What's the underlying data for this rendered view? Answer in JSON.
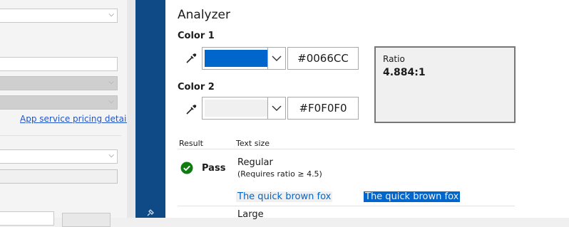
{
  "left_pane": {
    "pricing_link": "App service pricing details"
  },
  "analyzer": {
    "title": "Analyzer",
    "color1": {
      "label": "Color 1",
      "hex": "#0066CC",
      "swatch": "#0066CC"
    },
    "color2": {
      "label": "Color 2",
      "hex": "#F0F0F0",
      "swatch": "#F0F0F0"
    },
    "ratio": {
      "label": "Ratio",
      "value": "4.884:1"
    },
    "table": {
      "col_result": "Result",
      "col_text_size": "Text size",
      "rows": [
        {
          "result": "Pass",
          "size": "Regular",
          "requirement": "(Requires ratio ≥ 4.5)"
        },
        {
          "size": "Large"
        }
      ],
      "sample_text": "The quick brown fox"
    }
  },
  "colors": {
    "accent": "#0066CC",
    "sidebar_blue": "#0F4A87",
    "pass_green": "#107C10"
  },
  "icons": [
    "eyedropper-icon",
    "chevron-down-icon",
    "check-circle-icon",
    "pin-icon"
  ]
}
